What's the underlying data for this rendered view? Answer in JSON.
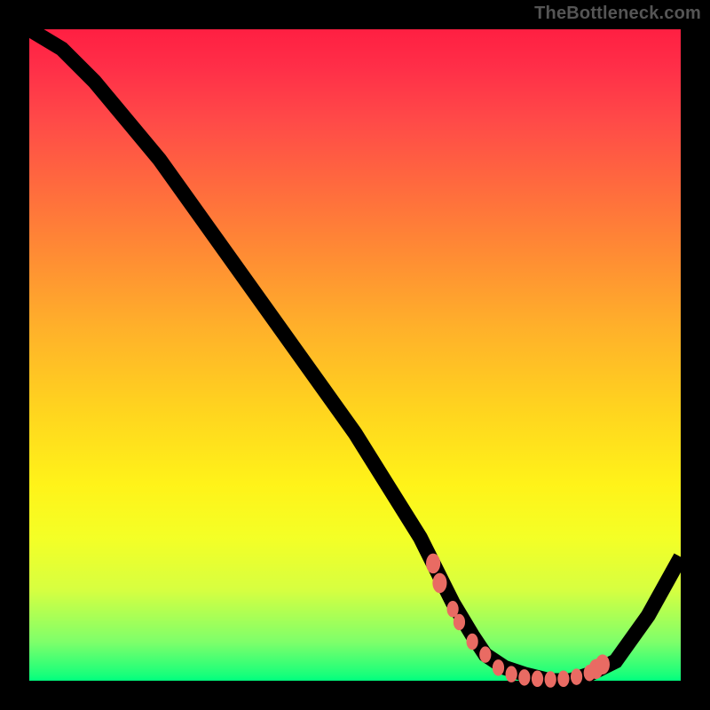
{
  "watermark": "TheBottleneck.com",
  "colors": {
    "frame_bg": "#000000",
    "dot_fill": "#e96b63",
    "curve_stroke": "#000000"
  },
  "chart_data": {
    "type": "line",
    "title": "",
    "xlabel": "",
    "ylabel": "",
    "xlim": [
      0,
      100
    ],
    "ylim": [
      0,
      100
    ],
    "grid": false,
    "legend": false,
    "series": [
      {
        "name": "curve",
        "x": [
          0,
          5,
          10,
          15,
          20,
          25,
          30,
          35,
          40,
          45,
          50,
          55,
          60,
          62,
          65,
          68,
          70,
          73,
          76,
          80,
          83,
          86,
          90,
          95,
          100
        ],
        "values": [
          100,
          97,
          92,
          86,
          80,
          73,
          66,
          59,
          52,
          45,
          38,
          30,
          22,
          18,
          12,
          7,
          4,
          2,
          1,
          0,
          0,
          1,
          3,
          10,
          19
        ]
      }
    ],
    "dots": [
      {
        "x": 62,
        "y": 18
      },
      {
        "x": 63,
        "y": 15
      },
      {
        "x": 65,
        "y": 11
      },
      {
        "x": 66,
        "y": 9
      },
      {
        "x": 68,
        "y": 6
      },
      {
        "x": 70,
        "y": 4
      },
      {
        "x": 72,
        "y": 2
      },
      {
        "x": 74,
        "y": 1
      },
      {
        "x": 76,
        "y": 0.5
      },
      {
        "x": 78,
        "y": 0.3
      },
      {
        "x": 80,
        "y": 0.2
      },
      {
        "x": 82,
        "y": 0.3
      },
      {
        "x": 84,
        "y": 0.6
      },
      {
        "x": 86,
        "y": 1.2
      },
      {
        "x": 87,
        "y": 1.8
      },
      {
        "x": 88,
        "y": 2.5
      }
    ]
  }
}
